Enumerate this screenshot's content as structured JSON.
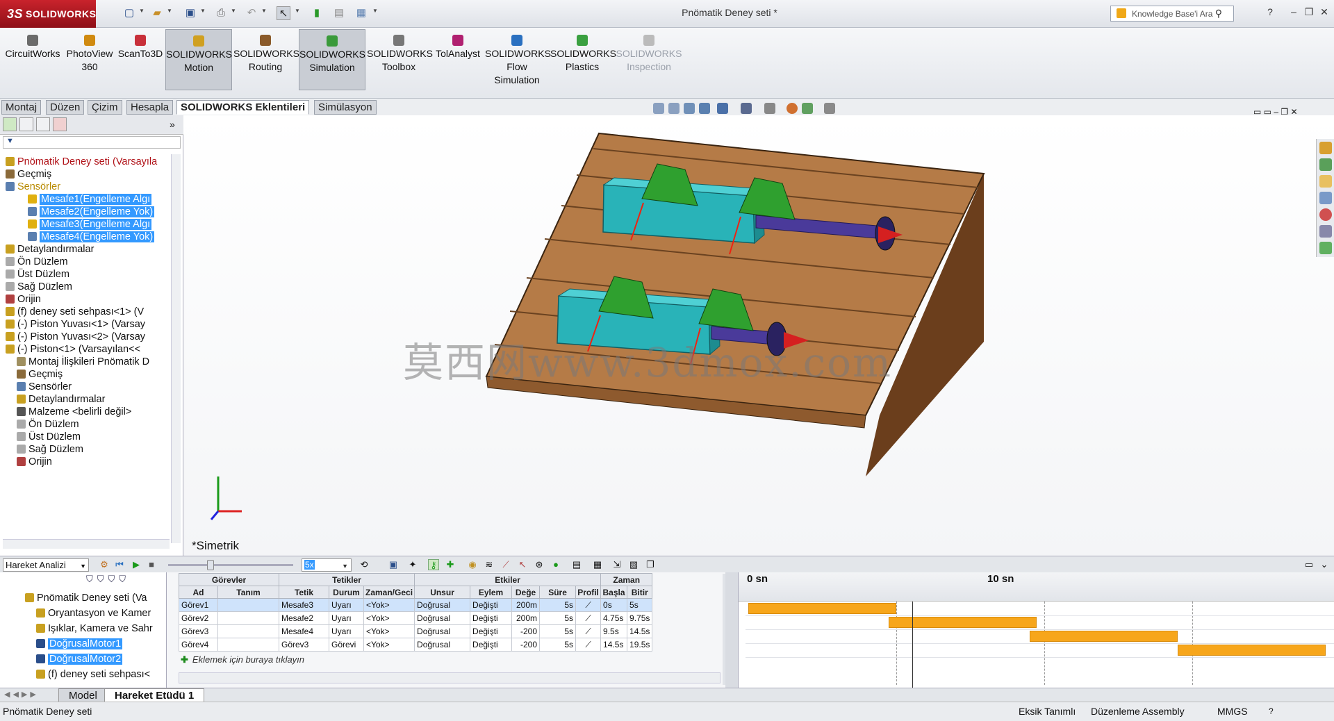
{
  "app": {
    "brand": "SOLIDWORKS",
    "doc_title": "Pnömatik Deney seti *",
    "search_placeholder": "Knowledge Base'i Ara"
  },
  "ribbon": [
    {
      "label": "CircuitWorks",
      "color": "#6b6b6b"
    },
    {
      "label": "PhotoView 360",
      "color": "#d08a10"
    },
    {
      "label": "ScanTo3D",
      "color": "#c8303a"
    },
    {
      "label": "SOLIDWORKS Motion",
      "color": "#d0a020",
      "active": true
    },
    {
      "label": "SOLIDWORKS Routing",
      "color": "#8a5a2a"
    },
    {
      "label": "SOLIDWORKS Simulation",
      "color": "#3a9a3a",
      "active": true
    },
    {
      "label": "SOLIDWORKS Toolbox",
      "color": "#777777"
    },
    {
      "label": "TolAnalyst",
      "color": "#b02070"
    },
    {
      "label": "SOLIDWORKS Flow Simulation",
      "color": "#2a70c0"
    },
    {
      "label": "SOLIDWORKS Plastics",
      "color": "#3aa040"
    },
    {
      "label": "SOLIDWORKS Inspection",
      "color": "#999999",
      "disabled": true
    }
  ],
  "command_tabs": [
    "Montaj",
    "Düzen",
    "Çizim",
    "Hesapla",
    "SOLIDWORKS Eklentileri",
    "Simülasyon"
  ],
  "active_command_tab": "SOLIDWORKS Eklentileri",
  "tree": [
    {
      "label": "Pnömatik Deney seti  (Varsayıla",
      "indent": 0,
      "type": "root",
      "icon": "assembly-icon"
    },
    {
      "label": "Geçmiş",
      "indent": 0,
      "icon": "history-icon"
    },
    {
      "label": "Sensörler",
      "indent": 0,
      "type": "warn",
      "icon": "sensor-icon"
    },
    {
      "label": "Mesafe1(Engelleme Algı",
      "indent": 2,
      "selected": true,
      "icon": "warning-icon"
    },
    {
      "label": "Mesafe2(Engelleme Yok)",
      "indent": 2,
      "selected": true,
      "icon": "sensor-icon"
    },
    {
      "label": "Mesafe3(Engelleme Algı",
      "indent": 2,
      "selected": true,
      "icon": "warning-icon"
    },
    {
      "label": "Mesafe4(Engelleme Yok)",
      "indent": 2,
      "selected": true,
      "icon": "sensor-icon"
    },
    {
      "label": "Detaylandırmalar",
      "indent": 0,
      "icon": "annotation-icon"
    },
    {
      "label": "Ön Düzlem",
      "indent": 0,
      "icon": "plane-icon"
    },
    {
      "label": "Üst Düzlem",
      "indent": 0,
      "icon": "plane-icon"
    },
    {
      "label": "Sağ Düzlem",
      "indent": 0,
      "icon": "plane-icon"
    },
    {
      "label": "Orijin",
      "indent": 0,
      "icon": "origin-icon"
    },
    {
      "label": "(f) deney seti sehpası<1> (V",
      "indent": 0,
      "icon": "part-icon"
    },
    {
      "label": "(-) Piston Yuvası<1> (Varsay",
      "indent": 0,
      "icon": "part-icon"
    },
    {
      "label": "(-) Piston Yuvası<2> (Varsay",
      "indent": 0,
      "icon": "part-icon"
    },
    {
      "label": "(-) Piston<1> (Varsayılan<<",
      "indent": 0,
      "icon": "part-icon"
    },
    {
      "label": "Montaj İlişkileri Pnömatik D",
      "indent": 1,
      "icon": "mate-icon"
    },
    {
      "label": "Geçmiş",
      "indent": 1,
      "icon": "history-icon"
    },
    {
      "label": "Sensörler",
      "indent": 1,
      "icon": "sensor-icon"
    },
    {
      "label": "Detaylandırmalar",
      "indent": 1,
      "icon": "annotation-icon"
    },
    {
      "label": "Malzeme <belirli değil>",
      "indent": 1,
      "icon": "material-icon"
    },
    {
      "label": "Ön Düzlem",
      "indent": 1,
      "icon": "plane-icon"
    },
    {
      "label": "Üst Düzlem",
      "indent": 1,
      "icon": "plane-icon"
    },
    {
      "label": "Sağ Düzlem",
      "indent": 1,
      "icon": "plane-icon"
    },
    {
      "label": "Orijin",
      "indent": 1,
      "icon": "origin-icon"
    }
  ],
  "viewport": {
    "view_name": "*Simetrik",
    "watermark": "莫西网www.3dmox.com"
  },
  "motion": {
    "study_type": "Hareket Analizi",
    "zoom": "5x",
    "tree": [
      {
        "label": "Pnömatik Deney seti  (Va",
        "indent": 1
      },
      {
        "label": "Oryantasyon ve Kamer",
        "indent": 2
      },
      {
        "label": "Işıklar, Kamera ve Sahr",
        "indent": 2
      },
      {
        "label": "DoğrusalMotor1",
        "indent": 2,
        "selected": true
      },
      {
        "label": "DoğrusalMotor2",
        "indent": 2,
        "selected": true
      },
      {
        "label": "(f) deney seti sehpası<",
        "indent": 2
      }
    ],
    "group_headers": [
      "Görevler",
      "Tetikler",
      "Etkiler",
      "Zaman"
    ],
    "columns": [
      "Ad",
      "Tanım",
      "Tetik",
      "Durum",
      "Zaman/Geci",
      "Unsur",
      "Eylem",
      "Değe",
      "Süre",
      "Profil",
      "Başla",
      "Bitir"
    ],
    "rows": [
      {
        "ad": "Görev1",
        "tanim": "",
        "tetik": "Mesafe3",
        "durum": "Uyarı",
        "zaman": "<Yok>",
        "unsur": "Doğrusal",
        "eylem": "Değişti",
        "deger": "200m",
        "sure": "5s",
        "basla": "0s",
        "bitir": "5s"
      },
      {
        "ad": "Görev2",
        "tanim": "",
        "tetik": "Mesafe2",
        "durum": "Uyarı",
        "zaman": "<Yok>",
        "unsur": "Doğrusal",
        "eylem": "Değişti",
        "deger": "200m",
        "sure": "5s",
        "basla": "4.75s",
        "bitir": "9.75s"
      },
      {
        "ad": "Görev3",
        "tanim": "",
        "tetik": "Mesafe4",
        "durum": "Uyarı",
        "zaman": "<Yok>",
        "unsur": "Doğrusal",
        "eylem": "Değişti",
        "deger": "-200",
        "sure": "5s",
        "basla": "9.5s",
        "bitir": "14.5s"
      },
      {
        "ad": "Görev4",
        "tanim": "",
        "tetik": "Görev3",
        "durum": "Görevi",
        "zaman": "<Yok>",
        "unsur": "Doğrusal",
        "eylem": "Değişti",
        "deger": "-200",
        "sure": "5s",
        "basla": "14.5s",
        "bitir": "19.5s"
      }
    ],
    "add_row": "Eklemek için buraya tıklayın",
    "timeline_labels": [
      "0 sn",
      "10 sn"
    ]
  },
  "bottom_tabs": [
    "Model",
    "Hareket Etüdü 1"
  ],
  "active_bottom_tab": "Hareket Etüdü 1",
  "status": {
    "doc": "Pnömatik Deney seti",
    "definition": "Eksik Tanımlı",
    "mode": "Düzenleme Assembly",
    "units": "MMGS"
  }
}
